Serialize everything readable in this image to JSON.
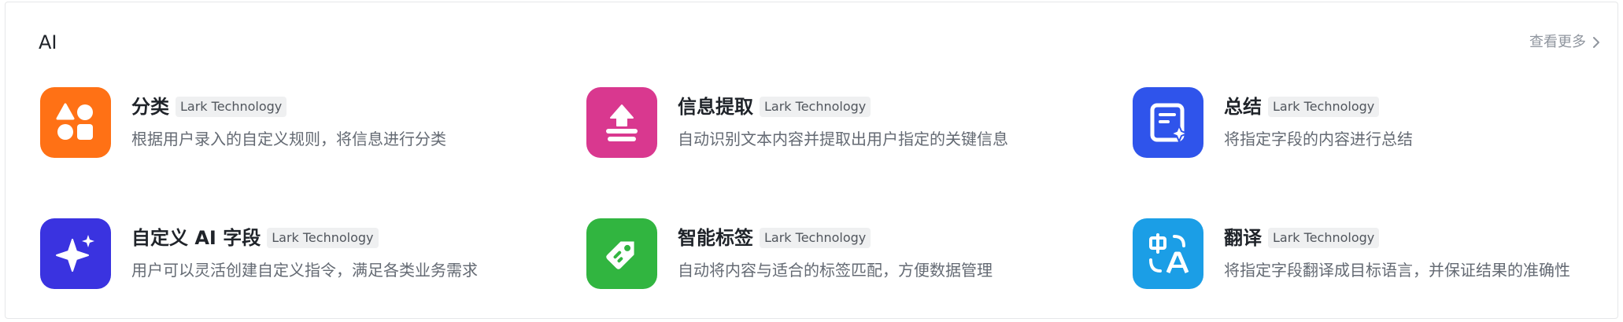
{
  "section": {
    "title": "AI",
    "see_more": "查看更多"
  },
  "cards": [
    {
      "name": "分类",
      "badge": "Lark Technology",
      "desc": "根据用户录入的自定义规则，将信息进行分类",
      "icon": "shapes-icon",
      "color": "#ff7115"
    },
    {
      "name": "信息提取",
      "badge": "Lark Technology",
      "desc": "自动识别文本内容并提取出用户指定的关键信息",
      "icon": "extract-icon",
      "color": "#d9388f"
    },
    {
      "name": "总结",
      "badge": "Lark Technology",
      "desc": "将指定字段的内容进行总结",
      "icon": "summary-icon",
      "color": "#2f54eb"
    },
    {
      "name": "自定义 AI 字段",
      "badge": "Lark Technology",
      "desc": "用户可以灵活创建自定义指令，满足各类业务需求",
      "icon": "sparkle-icon",
      "color": "#3a33e0"
    },
    {
      "name": "智能标签",
      "badge": "Lark Technology",
      "desc": "自动将内容与适合的标签匹配，方便数据管理",
      "icon": "tag-icon",
      "color": "#31b540"
    },
    {
      "name": "翻译",
      "badge": "Lark Technology",
      "desc": "将指定字段翻译成目标语言，并保证结果的准确性",
      "icon": "translate-icon",
      "color": "#1b9ee6"
    }
  ]
}
